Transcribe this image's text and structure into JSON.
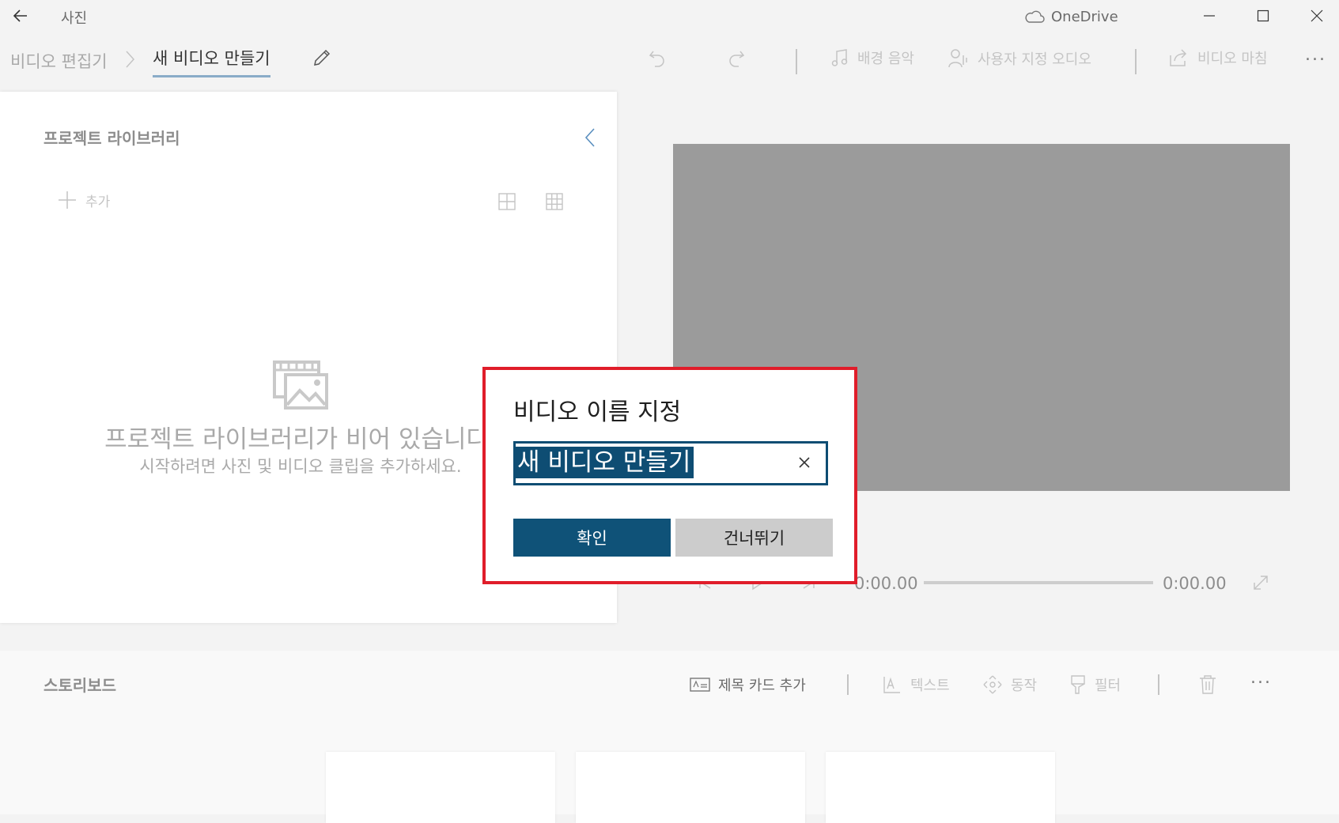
{
  "app": {
    "title": "사진",
    "onedrive_label": "OneDrive"
  },
  "breadcrumb": {
    "parent": "비디오 편집기",
    "current": "새 비디오 만들기"
  },
  "toolbar": {
    "background_music": "배경 음악",
    "custom_audio": "사용자 지정 오디오",
    "finish_video": "비디오 마침",
    "more": "..."
  },
  "library": {
    "title": "프로젝트 라이브러리",
    "add_label": "추가",
    "empty_title": "프로젝트 라이브러리가 비어 있습니다.",
    "empty_subtitle": "시작하려면 사진 및 비디오 클립을 추가하세요."
  },
  "playback": {
    "current_time": "0:00.00",
    "total_time": "0:00.00"
  },
  "storyboard": {
    "title": "스토리보드",
    "add_title_card": "제목 카드 추가",
    "text": "텍스트",
    "motion": "동작",
    "filters": "필터",
    "more": "..."
  },
  "dialog": {
    "title": "비디오 이름 지정",
    "name_value": "새 비디오 만들기",
    "ok_label": "확인",
    "skip_label": "건너뛰기",
    "highlight_color": "#e01d2a",
    "accent_color": "#0f5278"
  }
}
